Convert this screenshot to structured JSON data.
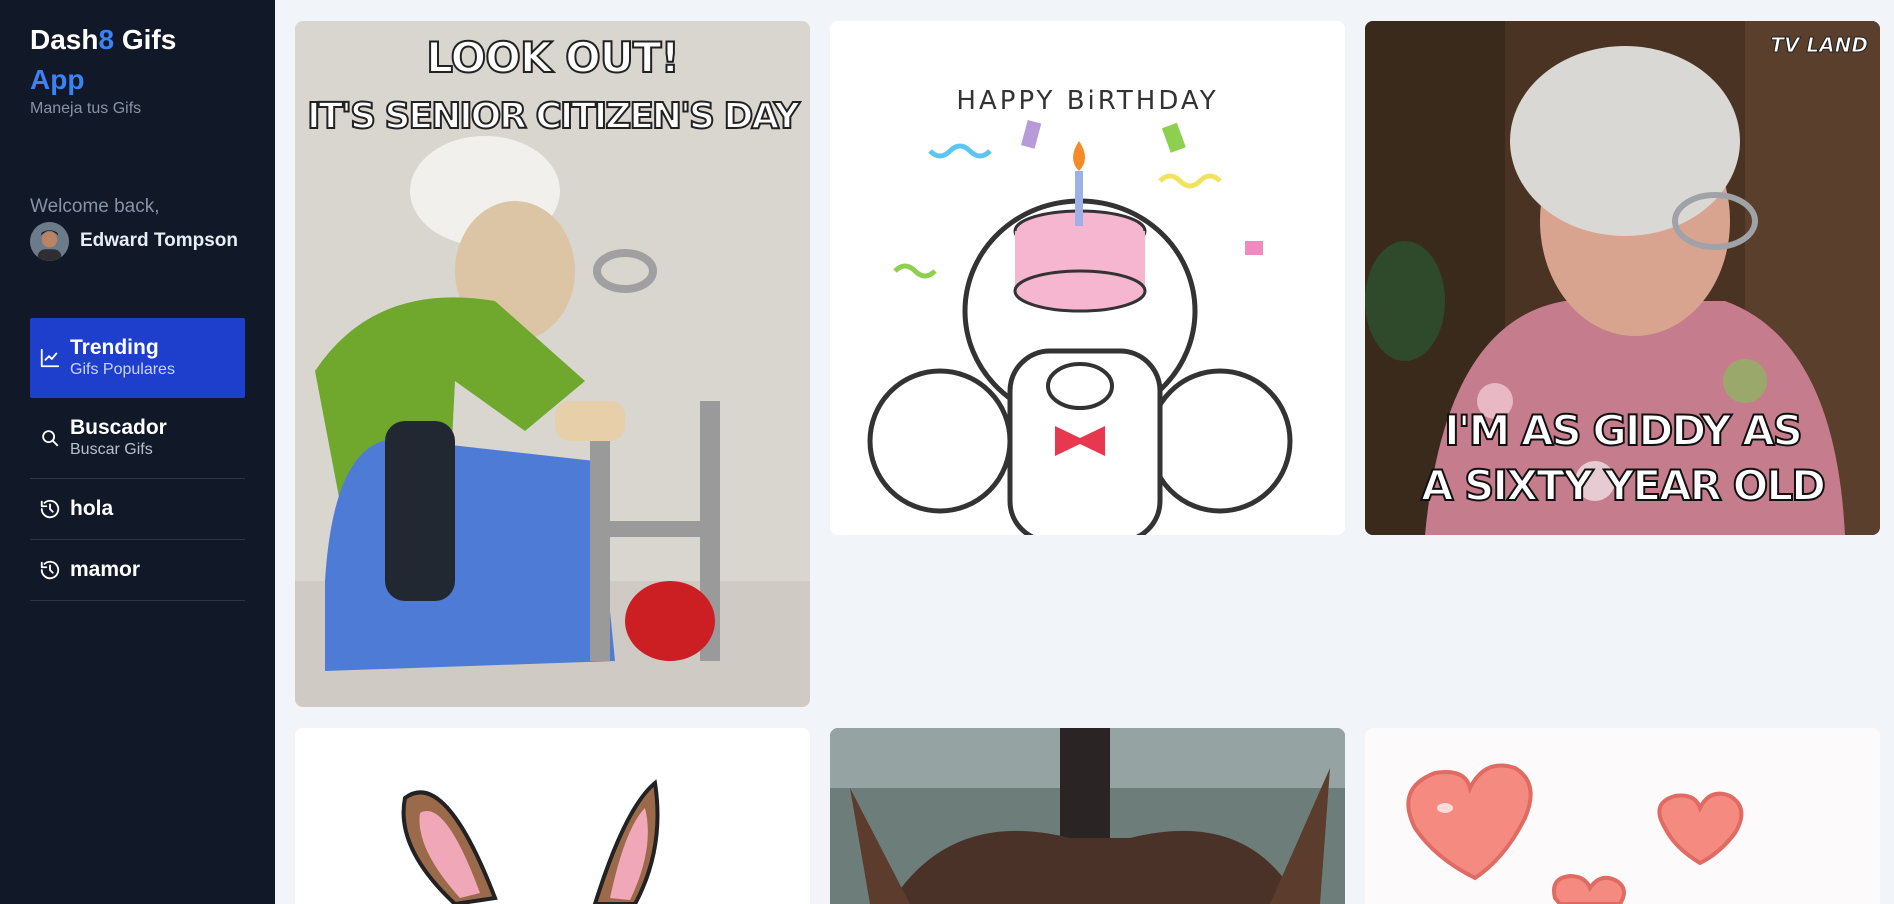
{
  "app": {
    "brand_part1": "Dash",
    "brand_accent": "8",
    "brand_part2": " Gifs",
    "brand_line2": "App",
    "subtitle": "Maneja tus Gifs"
  },
  "user": {
    "welcome": "Welcome back,",
    "name": "Edward Tompson"
  },
  "nav": {
    "items": [
      {
        "title": "Trending",
        "subtitle": "Gifs Populares",
        "icon": "trending-chart-icon",
        "active": true
      },
      {
        "title": "Buscador",
        "subtitle": "Buscar Gifs",
        "icon": "search-icon",
        "active": false
      },
      {
        "title": "hola",
        "icon": "history-icon",
        "active": false
      },
      {
        "title": "mamor",
        "icon": "history-icon",
        "active": false
      }
    ]
  },
  "gifs": [
    {
      "caption_top": "LOOK OUT!",
      "caption_bottom": "IT'S SENIOR CITIZEN'S DAY",
      "subject": "knitted grandma with walker"
    },
    {
      "caption_top": "HAPPY BiRTHDAY",
      "subject": "cartoon cats with birthday cake"
    },
    {
      "watermark": "TV LAND",
      "caption_top": "I'M AS GIDDY AS",
      "caption_bottom": "A SIXTY YEAR OLD",
      "subject": "woman in floral blouse"
    },
    {
      "subject": "cartoon bunny ears"
    },
    {
      "subject": "close-up through rainy glass"
    },
    {
      "subject": "pink hearts"
    }
  ],
  "colors": {
    "sidebar_bg": "#111827",
    "accent": "#3b82f6",
    "active_nav": "#1e3fcc",
    "content_bg": "#f1f4f9"
  }
}
